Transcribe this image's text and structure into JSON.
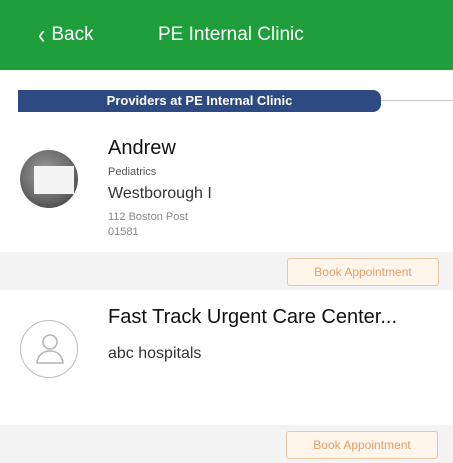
{
  "navbar": {
    "back_label": "Back",
    "title": "PE Internal Clinic",
    "color": "#1f9f3c"
  },
  "section": {
    "header": "Providers at PE Internal Clinic",
    "color": "#2d4a82"
  },
  "providers": [
    {
      "name": "Andrew",
      "specialty": "Pediatrics",
      "location": "Westborough I",
      "address_line1": "112 Boston Post",
      "address_line2": "01581",
      "avatar": "photo",
      "book_label": "Book Appointment"
    },
    {
      "name": "Fast Track Urgent Care Center...",
      "hospital": "abc hospitals",
      "avatar": "person-icon",
      "book_label": "Book Appointment"
    }
  ],
  "button_accent": "#e0a06a"
}
